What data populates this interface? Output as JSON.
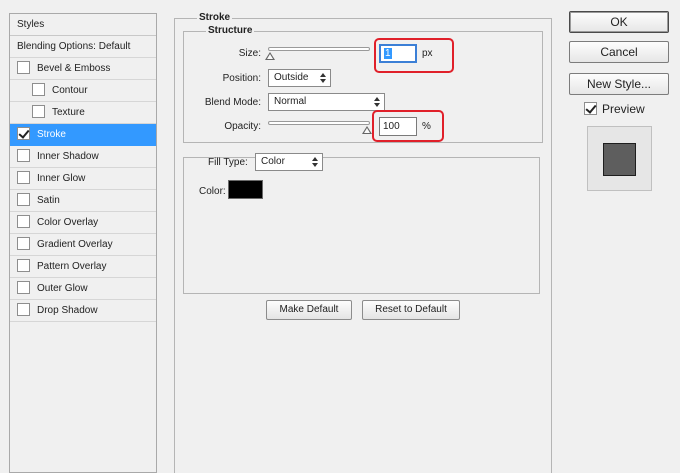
{
  "styles_panel": {
    "header": "Styles",
    "items": [
      {
        "label": "Blending Options: Default",
        "checkbox": false,
        "checked": false,
        "indent": false,
        "selected": false
      },
      {
        "label": "Bevel & Emboss",
        "checkbox": true,
        "checked": false,
        "indent": false,
        "selected": false
      },
      {
        "label": "Contour",
        "checkbox": true,
        "checked": false,
        "indent": true,
        "selected": false
      },
      {
        "label": "Texture",
        "checkbox": true,
        "checked": false,
        "indent": true,
        "selected": false
      },
      {
        "label": "Stroke",
        "checkbox": true,
        "checked": true,
        "indent": false,
        "selected": true
      },
      {
        "label": "Inner Shadow",
        "checkbox": true,
        "checked": false,
        "indent": false,
        "selected": false
      },
      {
        "label": "Inner Glow",
        "checkbox": true,
        "checked": false,
        "indent": false,
        "selected": false
      },
      {
        "label": "Satin",
        "checkbox": true,
        "checked": false,
        "indent": false,
        "selected": false
      },
      {
        "label": "Color Overlay",
        "checkbox": true,
        "checked": false,
        "indent": false,
        "selected": false
      },
      {
        "label": "Gradient Overlay",
        "checkbox": true,
        "checked": false,
        "indent": false,
        "selected": false
      },
      {
        "label": "Pattern Overlay",
        "checkbox": true,
        "checked": false,
        "indent": false,
        "selected": false
      },
      {
        "label": "Outer Glow",
        "checkbox": true,
        "checked": false,
        "indent": false,
        "selected": false
      },
      {
        "label": "Drop Shadow",
        "checkbox": true,
        "checked": false,
        "indent": false,
        "selected": false
      }
    ]
  },
  "stroke": {
    "title": "Stroke",
    "structure_title": "Structure",
    "size_label": "Size:",
    "size_value": "1",
    "size_unit": "px",
    "position_label": "Position:",
    "position_value": "Outside",
    "blend_mode_label": "Blend Mode:",
    "blend_mode_value": "Normal",
    "opacity_label": "Opacity:",
    "opacity_value": "100",
    "opacity_unit": "%",
    "fill_type_label": "Fill Type:",
    "fill_type_value": "Color",
    "color_label": "Color:",
    "stroke_color": "#000000",
    "make_default_label": "Make Default",
    "reset_default_label": "Reset to Default"
  },
  "actions": {
    "ok_label": "OK",
    "cancel_label": "Cancel",
    "new_style_label": "New Style...",
    "preview_label": "Preview",
    "preview_checked": true
  },
  "colors": {
    "selection": "#3399ff",
    "highlight": "#e0202a",
    "preview_swatch": "#5e5e5e"
  }
}
